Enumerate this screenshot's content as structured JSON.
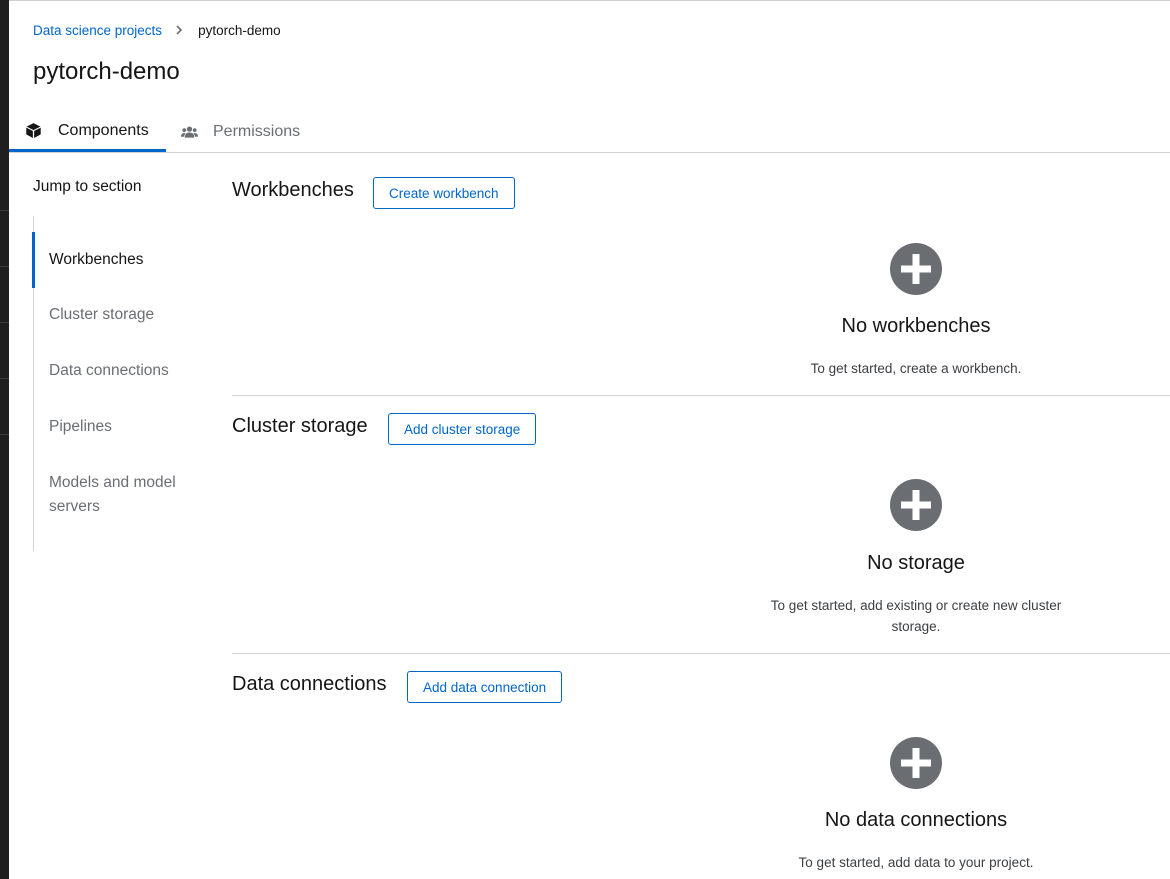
{
  "breadcrumb": {
    "parent": "Data science projects",
    "current": "pytorch-demo"
  },
  "page_title": "pytorch-demo",
  "tabs": [
    {
      "label": "Components",
      "icon": "cube-icon",
      "active": true
    },
    {
      "label": "Permissions",
      "icon": "users-icon",
      "active": false
    }
  ],
  "jump_to_section": {
    "title": "Jump to section",
    "items": [
      {
        "label": "Workbenches",
        "active": true
      },
      {
        "label": "Cluster storage",
        "active": false
      },
      {
        "label": "Data connections",
        "active": false
      },
      {
        "label": "Pipelines",
        "active": false
      },
      {
        "label": "Models and model servers",
        "active": false
      }
    ]
  },
  "sections": {
    "workbenches": {
      "title": "Workbenches",
      "button": "Create workbench",
      "empty_title": "No workbenches",
      "empty_body": "To get started, create a workbench."
    },
    "cluster_storage": {
      "title": "Cluster storage",
      "button": "Add cluster storage",
      "empty_title": "No storage",
      "empty_body": "To get started, add existing or create new cluster storage."
    },
    "data_connections": {
      "title": "Data connections",
      "button": "Add data connection",
      "empty_title": "No data connections",
      "empty_body": "To get started, add data to your project."
    }
  },
  "colors": {
    "link": "#0066cc",
    "icon_grey": "#6a6e73",
    "text": "#151515"
  }
}
